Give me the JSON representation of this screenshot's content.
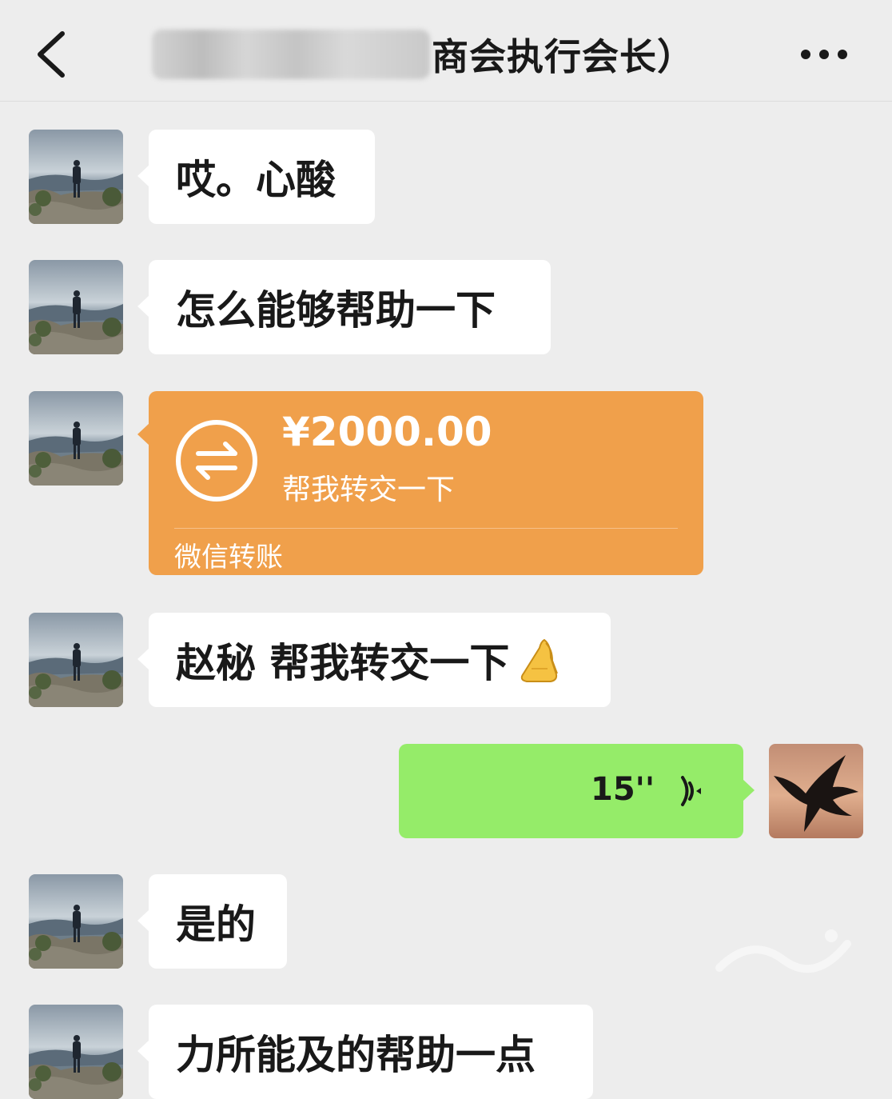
{
  "header": {
    "title_visible": "商会执行会长）",
    "back_icon": "chevron-left-icon",
    "more_icon": "more-dots-icon"
  },
  "messages": [
    {
      "side": "left",
      "type": "text",
      "text": "哎。心酸"
    },
    {
      "side": "left",
      "type": "text",
      "text": "怎么能够帮助一下"
    },
    {
      "side": "left",
      "type": "transfer",
      "amount": "¥2000.00",
      "note": "帮我转交一下",
      "footer": "微信转账",
      "icon": "transfer-arrows-icon",
      "color": "#f0a04b"
    },
    {
      "side": "left",
      "type": "text",
      "text": "赵秘 帮我转交一下",
      "emoji": "pray-hands-icon"
    },
    {
      "side": "right",
      "type": "voice",
      "duration": "15''",
      "icon": "voice-wave-icon",
      "color": "#95ec69"
    },
    {
      "side": "left",
      "type": "text",
      "text": "是的"
    },
    {
      "side": "left",
      "type": "text",
      "text": "力所能及的帮助一点"
    }
  ],
  "colors": {
    "background": "#ededed",
    "bubble_in": "#ffffff",
    "bubble_out": "#95ec69",
    "transfer": "#f0a04b"
  }
}
